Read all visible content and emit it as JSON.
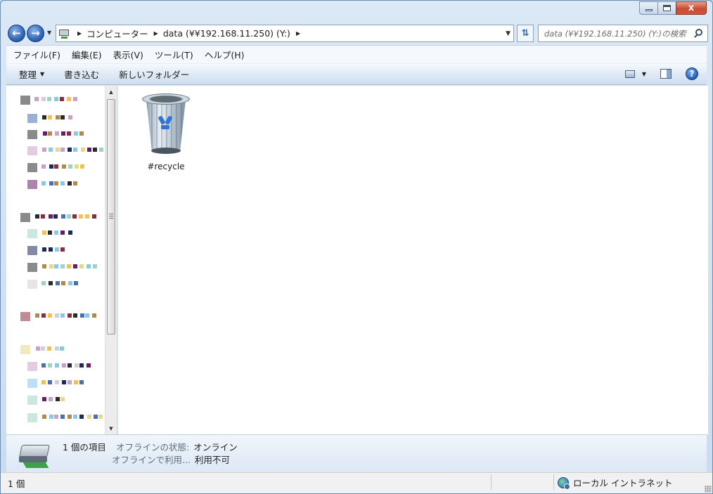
{
  "window": {
    "caption_close": "x"
  },
  "address": {
    "crumbs": [
      "コンピューター",
      "data (¥¥192.168.11.250) (Y:)"
    ],
    "search_placeholder": "data (¥¥192.168.11.250) (Y:)の検索"
  },
  "menu": [
    "ファイル(F)",
    "編集(E)",
    "表示(V)",
    "ツール(T)",
    "ヘルプ(H)"
  ],
  "toolbar": {
    "organize": "整理",
    "burn": "書き込む",
    "new_folder": "新しいフォルダー"
  },
  "files": [
    {
      "name": "#recycle",
      "icon": "recycle-bin-icon"
    }
  ],
  "details": {
    "count": "1 個の項目",
    "offline_status_key": "オフラインの状態:",
    "offline_status_value": "オンライン",
    "offline_avail_key": "オフラインで利用...",
    "offline_avail_value": "利用不可"
  },
  "status": {
    "items": "1 個",
    "zone": "ローカル イントラネット"
  },
  "colors": {
    "accent": "#2f67b6",
    "close": "#c74b32",
    "selection": "#3399ff"
  }
}
